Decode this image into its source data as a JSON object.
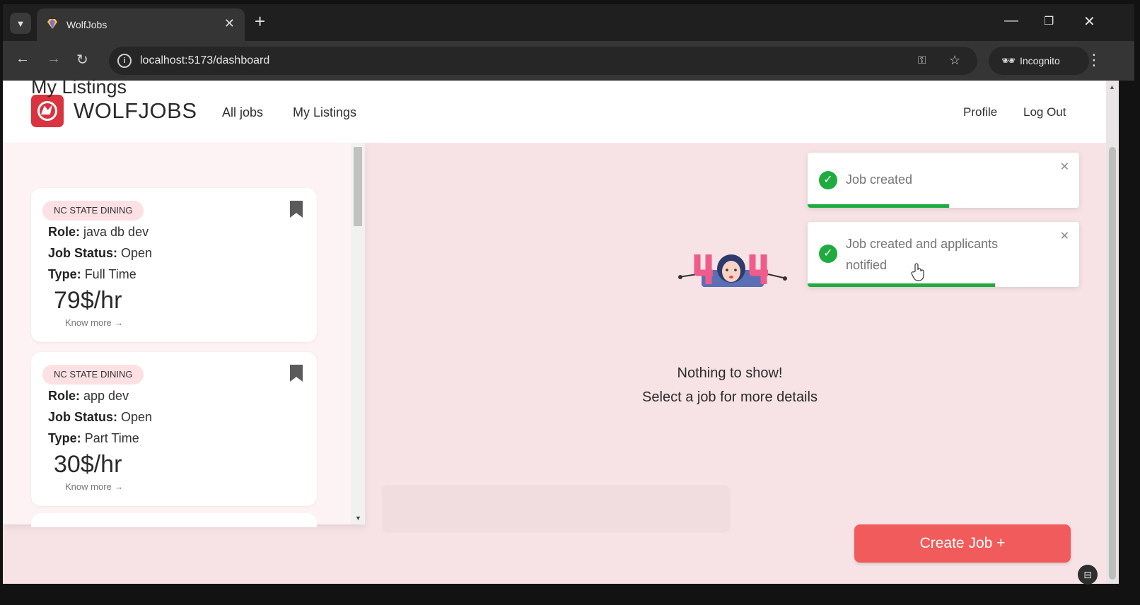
{
  "browser": {
    "tab_title": "WolfJobs",
    "tab_close": "✕",
    "new_tab": "+",
    "url": "localhost:5173/dashboard",
    "incognito_label": "Incognito",
    "icons": [
      "back-icon",
      "forward-icon",
      "reload-icon",
      "site-info-icon",
      "password-key-icon",
      "star-icon",
      "incognito-icon",
      "menu-icon"
    ]
  },
  "header": {
    "brand": "WOLFJOBS",
    "nav": {
      "all_jobs": "All jobs",
      "my_listings": "My Listings"
    },
    "profile": "Profile",
    "logout": "Log Out"
  },
  "listings": {
    "title": "My Listings",
    "cards": [
      {
        "company": "NC STATE DINING",
        "role_label": "Role:",
        "role": "java db dev",
        "status_label": "Job Status:",
        "status": "Open",
        "type_label": "Type:",
        "type": "Full Time",
        "pay": "79$/hr",
        "more": "Know more →"
      },
      {
        "company": "NC STATE DINING",
        "role_label": "Role:",
        "role": "app dev",
        "status_label": "Job Status:",
        "status": "Open",
        "type_label": "Type:",
        "type": "Part Time",
        "pay": "30$/hr",
        "more": "Know more →"
      }
    ]
  },
  "empty_state": {
    "line1": "Nothing to show!",
    "line2": "Select a job for more details"
  },
  "toasts": [
    {
      "message": "Job created",
      "progress": 0.52
    },
    {
      "message_line1": "Job created and applicants",
      "message_line2": "notified",
      "progress": 0.69
    }
  ],
  "create_button": "Create Job +",
  "colors": {
    "brand_red": "#d9333f",
    "button_red": "#f25b5b",
    "page_bg": "#f7e3e6",
    "success_green": "#1fab3f"
  }
}
